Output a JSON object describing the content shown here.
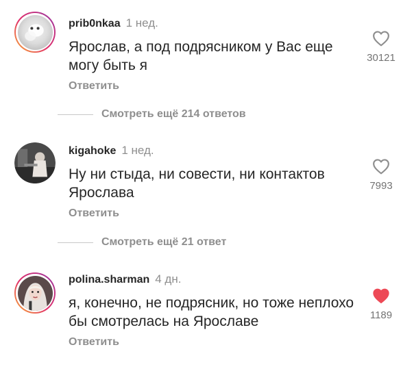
{
  "comments": [
    {
      "username": "prib0nkaa",
      "time": "1 нед.",
      "text": "Ярослав, а под подрясником у Вас еще могу быть я",
      "reply_label": "Ответить",
      "likes": "30121",
      "liked": false,
      "avatar_icon": "avatar-photo"
    },
    {
      "username": "kigahoke",
      "time": "1 нед.",
      "text": "Ну ни стыда, ни совести, ни контактов Ярослава",
      "reply_label": "Ответить",
      "likes": "7993",
      "liked": false,
      "avatar_icon": "avatar-photo"
    },
    {
      "username": "polina.sharman",
      "time": "4 дн.",
      "text": "я, конечно, не подрясник, но тоже неплохо бы смотрелась на Ярославе",
      "reply_label": "Ответить",
      "likes": "1189",
      "liked": true,
      "avatar_icon": "avatar-photo"
    }
  ],
  "view_more": [
    {
      "label": "Смотреть ещё 214 ответов"
    },
    {
      "label": "Смотреть ещё 21 ответ"
    }
  ],
  "colors": {
    "text": "#262626",
    "muted": "#8e8e8e",
    "liked_heart": "#ed4956",
    "story_ring": [
      "#f9b233",
      "#e1306c",
      "#c13584",
      "#833ab4"
    ]
  }
}
